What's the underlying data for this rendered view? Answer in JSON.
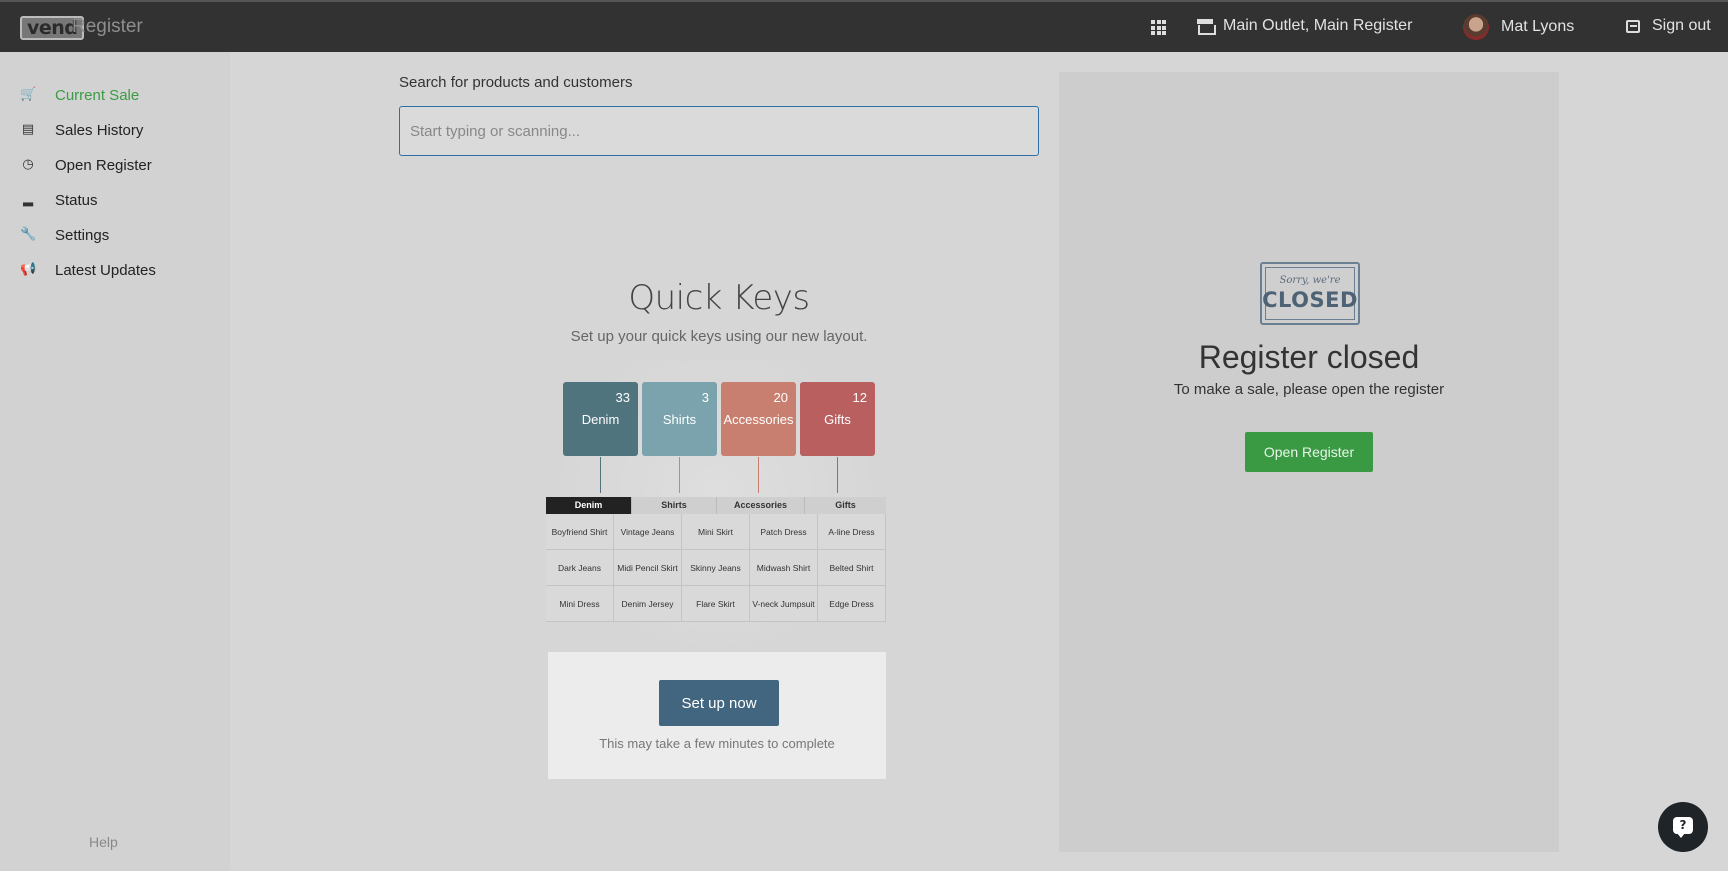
{
  "header": {
    "logo": "vend",
    "app_name": "Register",
    "apps_icon": "grid-icon",
    "outlet": "Main Outlet, Main Register",
    "user_name": "Mat Lyons",
    "signout": "Sign out"
  },
  "sidebar": {
    "items": [
      {
        "label": "Current Sale",
        "icon": "cart-icon",
        "glyph": "🛒",
        "active": true
      },
      {
        "label": "Sales History",
        "icon": "history-icon",
        "glyph": "▤",
        "active": false
      },
      {
        "label": "Open Register",
        "icon": "clock-icon",
        "glyph": "◷",
        "active": false
      },
      {
        "label": "Status",
        "icon": "signal-icon",
        "glyph": "▂",
        "active": false
      },
      {
        "label": "Settings",
        "icon": "wrench-icon",
        "glyph": "🔧",
        "active": false
      },
      {
        "label": "Latest Updates",
        "icon": "megaphone-icon",
        "glyph": "📢",
        "active": false
      }
    ],
    "help": "Help"
  },
  "search": {
    "label": "Search for products and customers",
    "placeholder": "Start typing or scanning...",
    "value": ""
  },
  "quick_keys": {
    "title": "Quick Keys",
    "subtitle": "Set up your quick keys using our new layout.",
    "categories": [
      {
        "name": "Denim",
        "count": "33",
        "color": "#50747e"
      },
      {
        "name": "Shirts",
        "count": "3",
        "color": "#7aa3ad"
      },
      {
        "name": "Accessories",
        "count": "20",
        "color": "#c97f6f"
      },
      {
        "name": "Gifts",
        "count": "12",
        "color": "#b95f5f"
      }
    ],
    "tabs": [
      "Denim",
      "Shirts",
      "Accessories",
      "Gifts"
    ],
    "grid": [
      "Boyfriend Shirt",
      "Vintage Jeans",
      "Mini Skirt",
      "Patch Dress",
      "A-line Dress",
      "Dark Jeans",
      "Midi Pencil Skirt",
      "Skinny Jeans",
      "Midwash Shirt",
      "Belted Shirt",
      "Mini Dress",
      "Denim Jersey",
      "Flare Skirt",
      "V-neck Jumpsuit",
      "Edge Dress"
    ],
    "setup_button": "Set up now",
    "setup_note": "This may take a few minutes to complete"
  },
  "register": {
    "sign_sorry": "Sorry, we're",
    "sign_closed": "CLOSED",
    "title": "Register closed",
    "subtitle": "To make a sale, please open the register",
    "open_button": "Open Register"
  },
  "colors": {
    "accent_green": "#3a9a44",
    "setup_blue": "#426680",
    "topbar": "#323232"
  },
  "chat": {
    "icon": "chat-help-icon",
    "glyph": "?"
  }
}
